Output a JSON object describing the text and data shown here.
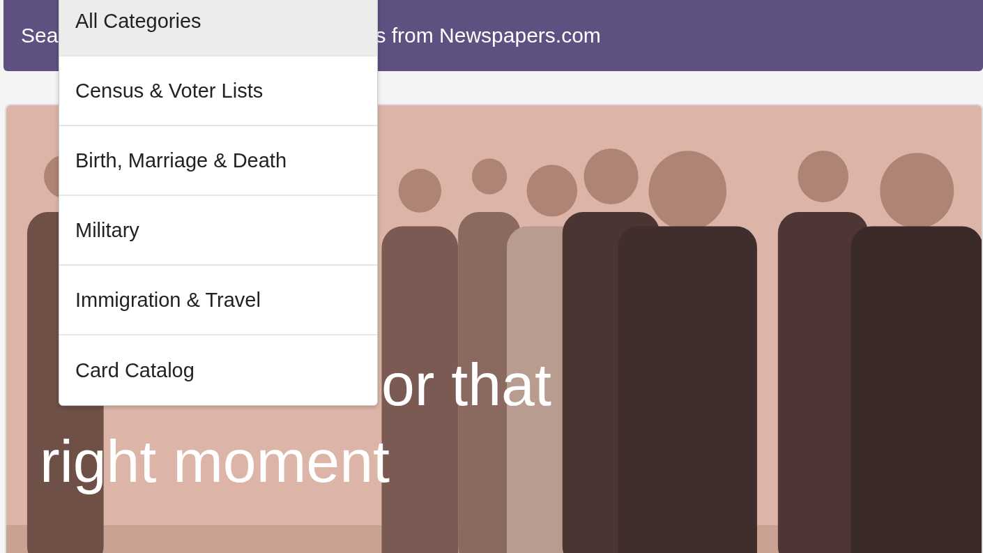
{
  "banner": {
    "text_start": "Sea",
    "text_end": "s from Newspapers.com"
  },
  "hero": {
    "heading_lines": [
      "or that",
      "right moment"
    ]
  },
  "category_menu": {
    "items": [
      {
        "label": "All Categories",
        "selected": true
      },
      {
        "label": "Census & Voter Lists",
        "selected": false
      },
      {
        "label": "Birth, Marriage & Death",
        "selected": false
      },
      {
        "label": "Military",
        "selected": false
      },
      {
        "label": "Immigration & Travel",
        "selected": false
      },
      {
        "label": "Card Catalog",
        "selected": false
      }
    ]
  }
}
